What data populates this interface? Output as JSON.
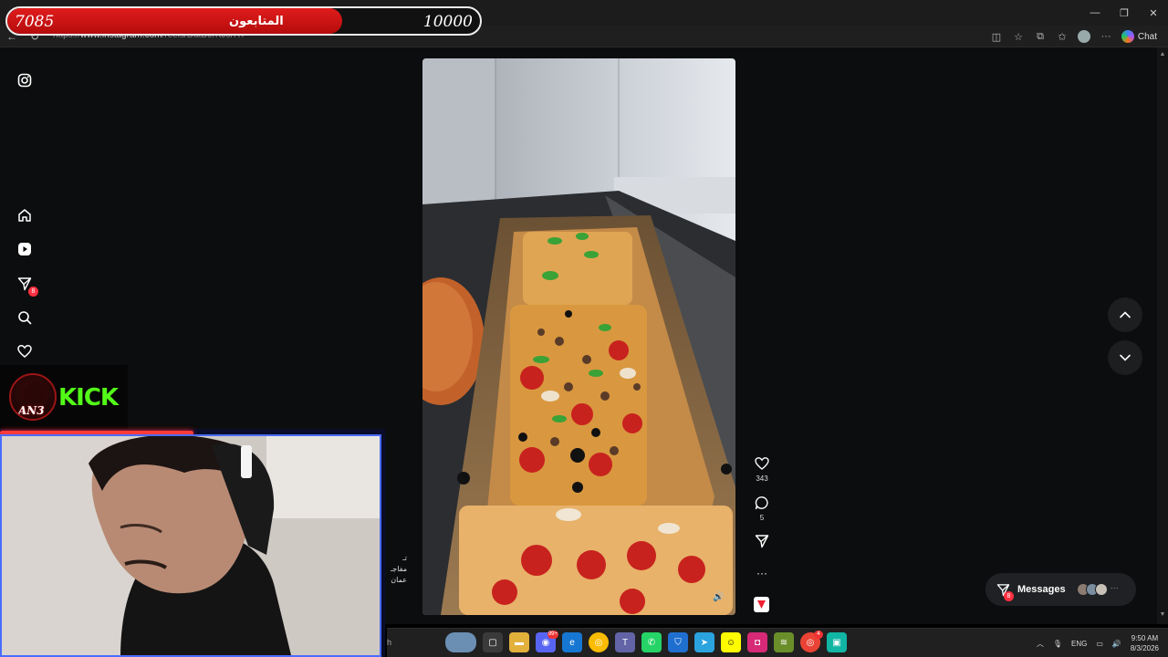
{
  "browser": {
    "url_prefix": "https://",
    "url_host": "www.instagram.com",
    "url_path": "/reels/DatDJrKJcrfY/",
    "chat_label": "Chat",
    "window_controls": [
      "—",
      "❐",
      "✕"
    ]
  },
  "followers_overlay": {
    "current": "7085",
    "label": "المتابعون",
    "goal": "10000",
    "progress": 0.7085
  },
  "instagram": {
    "sidebar": [
      "instagram-logo",
      "home-icon",
      "reels-icon",
      "messages-icon",
      "search-icon",
      "notifications-icon"
    ],
    "messages_badge": "8",
    "actions": {
      "likes": "343",
      "comments": "5"
    },
    "messages_button": {
      "label": "Messages",
      "badge": "8",
      "more": "···"
    },
    "caption_lines": [
      "تـ",
      "مفاجـ",
      "عمان"
    ]
  },
  "stream_overlay": {
    "kick_text": "KICK",
    "logo_text": "AN3"
  },
  "taskbar": {
    "search_fragment": "h",
    "discord_badge": "99+",
    "chrome_badge": "4",
    "language": "ENG",
    "time": "9:50 AM",
    "date": "8/3/2026"
  },
  "colors": {
    "kick_green": "#53fc18",
    "followers_red": "#e01c1c",
    "instagram_badge": "#ff3040"
  }
}
